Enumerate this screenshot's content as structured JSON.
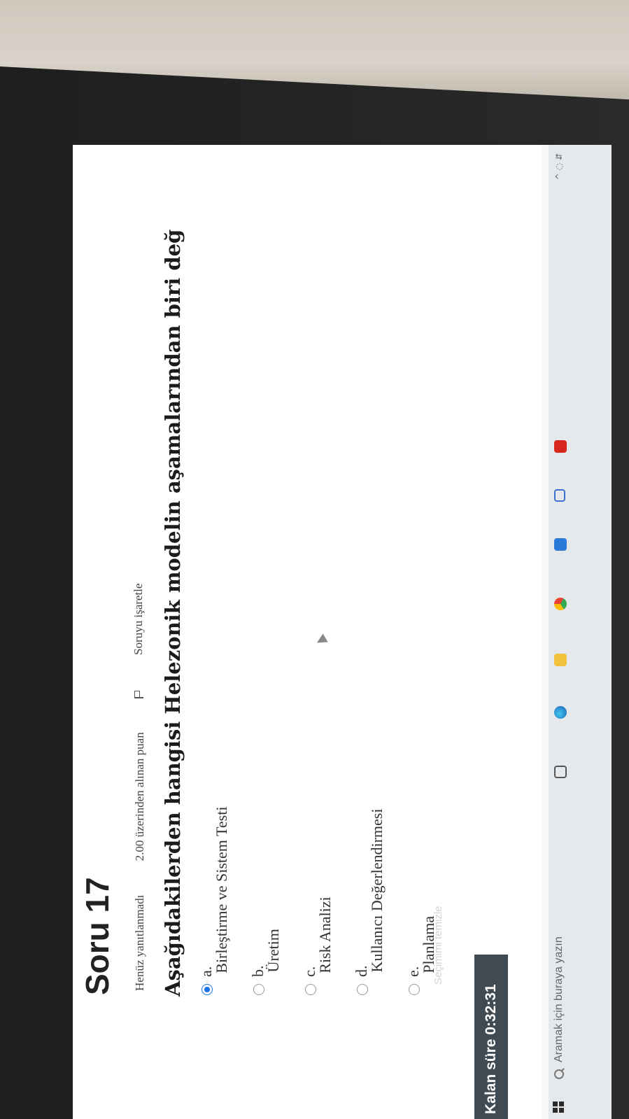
{
  "question": {
    "title": "Soru 17",
    "status": "Henüz yanıtlanmadı",
    "points": "2.00 üzerinden alınan puan",
    "flag_label": "Soruyu işaretle",
    "text": "Aşağıdakilerden hangisi Helezonik modelin aşamalarından biri değ"
  },
  "options": [
    {
      "letter": "a.",
      "label": "Birleştirme ve Sistem Testi",
      "checked": true
    },
    {
      "letter": "b.",
      "label": "Üretim",
      "checked": false
    },
    {
      "letter": "c.",
      "label": "Risk Analizi",
      "checked": false
    },
    {
      "letter": "d.",
      "label": "Kullanıcı Değerlendirmesi",
      "checked": false
    },
    {
      "letter": "e.",
      "label": "Planlama",
      "checked": false
    }
  ],
  "clear_choice": "Seçimimi temizle",
  "timer": "Kalan süre 0:32:31",
  "taskbar": {
    "search_placeholder": "Aramak için buraya yazın",
    "apps": [
      "task-view-icon",
      "edge-icon",
      "file-explorer-icon",
      "chrome-icon",
      "store-icon",
      "mail-icon",
      "acrobat-icon"
    ]
  },
  "colors": {
    "accent": "#1a73e8",
    "timer_bg": "#3f4a52"
  }
}
